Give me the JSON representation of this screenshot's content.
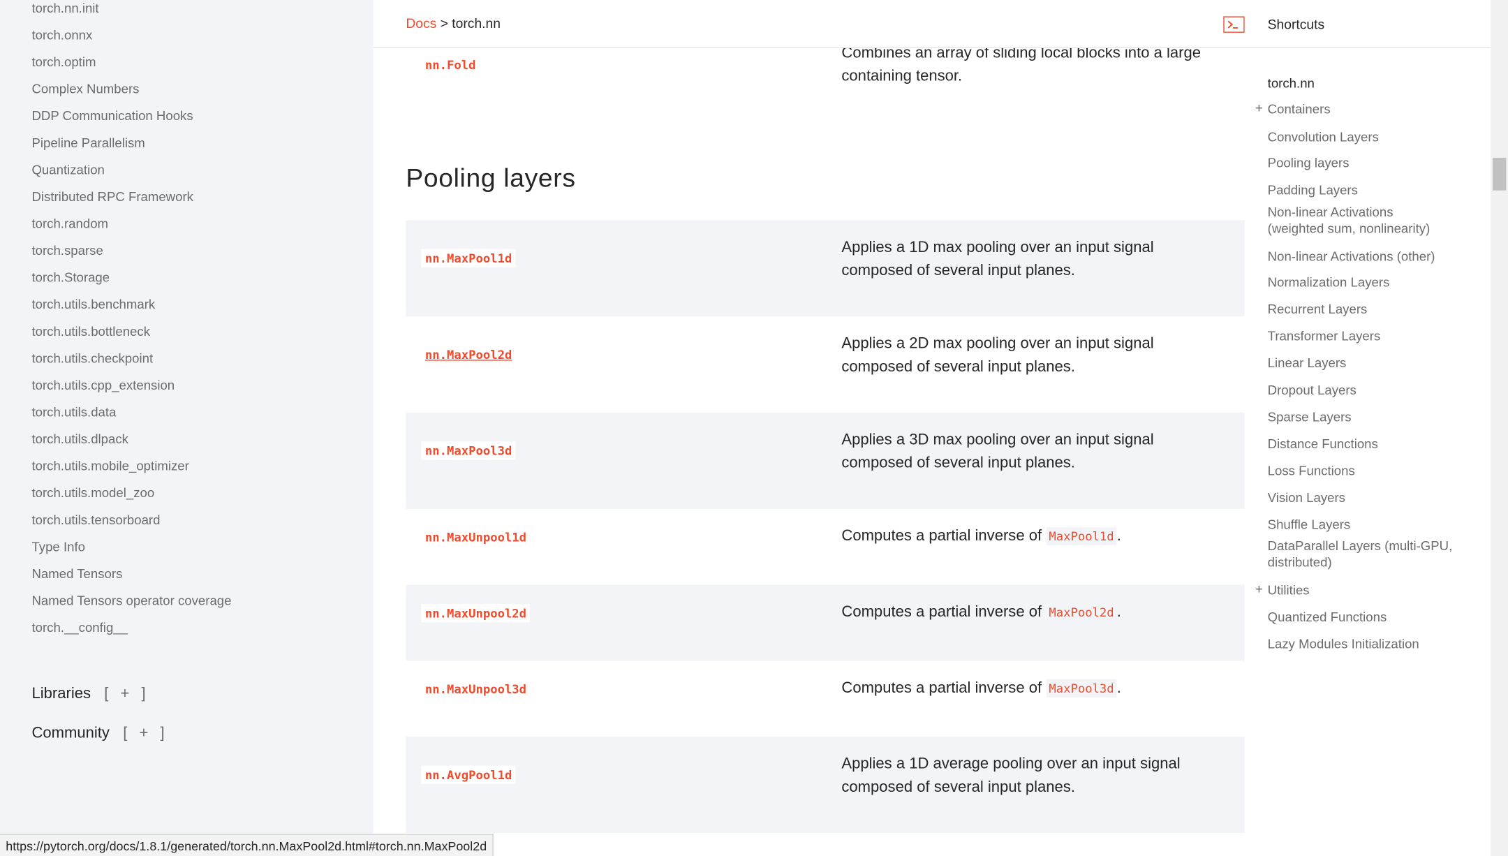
{
  "sidebar": {
    "items": [
      "torch.nn.init",
      "torch.onnx",
      "torch.optim",
      "Complex Numbers",
      "DDP Communication Hooks",
      "Pipeline Parallelism",
      "Quantization",
      "Distributed RPC Framework",
      "torch.random",
      "torch.sparse",
      "torch.Storage",
      "torch.utils.benchmark",
      "torch.utils.bottleneck",
      "torch.utils.checkpoint",
      "torch.utils.cpp_extension",
      "torch.utils.data",
      "torch.utils.dlpack",
      "torch.utils.mobile_optimizer",
      "torch.utils.model_zoo",
      "torch.utils.tensorboard",
      "Type Info",
      "Named Tensors",
      "Named Tensors operator coverage",
      "torch.__config__"
    ],
    "sections": [
      {
        "label": "Libraries",
        "expander": "[ + ]"
      },
      {
        "label": "Community",
        "expander": "[ + ]"
      }
    ]
  },
  "header": {
    "breadcrumb_link": "Docs",
    "breadcrumb_sep": ">",
    "breadcrumb_current": "torch.nn",
    "shortcuts_label": "Shortcuts"
  },
  "content": {
    "fold": {
      "code": "nn.Fold",
      "desc": "Combines an array of sliding local blocks into a large containing tensor."
    },
    "section_title": "Pooling layers",
    "rows": [
      {
        "code": "nn.MaxPool1d",
        "desc": "Applies a 1D max pooling over an input signal composed of several input planes."
      },
      {
        "code": "nn.MaxPool2d",
        "desc": "Applies a 2D max pooling over an input signal composed of several input planes."
      },
      {
        "code": "nn.MaxPool3d",
        "desc": "Applies a 3D max pooling over an input signal composed of several input planes."
      },
      {
        "code": "nn.MaxUnpool1d",
        "desc_prefix": "Computes a partial inverse of",
        "desc_code": "MaxPool1d",
        "desc_suffix": "."
      },
      {
        "code": "nn.MaxUnpool2d",
        "desc_prefix": "Computes a partial inverse of",
        "desc_code": "MaxPool2d",
        "desc_suffix": "."
      },
      {
        "code": "nn.MaxUnpool3d",
        "desc_prefix": "Computes a partial inverse of",
        "desc_code": "MaxPool3d",
        "desc_suffix": "."
      },
      {
        "code": "nn.AvgPool1d",
        "desc": "Applies a 1D average pooling over an input signal composed of several input planes."
      }
    ]
  },
  "right_nav": {
    "items": [
      {
        "label": "torch.nn"
      },
      {
        "label": "Containers",
        "expander": "+"
      },
      {
        "label": "Convolution Layers"
      },
      {
        "label": "Pooling layers"
      },
      {
        "label": "Padding Layers"
      },
      {
        "label": "Non-linear Activations (weighted sum, nonlinearity)"
      },
      {
        "label": "Non-linear Activations (other)"
      },
      {
        "label": "Normalization Layers"
      },
      {
        "label": "Recurrent Layers"
      },
      {
        "label": "Transformer Layers"
      },
      {
        "label": "Linear Layers"
      },
      {
        "label": "Dropout Layers"
      },
      {
        "label": "Sparse Layers"
      },
      {
        "label": "Distance Functions"
      },
      {
        "label": "Loss Functions"
      },
      {
        "label": "Vision Layers"
      },
      {
        "label": "Shuffle Layers"
      },
      {
        "label": "DataParallel Layers (multi-GPU, distributed)"
      },
      {
        "label": "Utilities",
        "expander": "+"
      },
      {
        "label": "Quantized Functions"
      },
      {
        "label": "Lazy Modules Initialization"
      }
    ]
  },
  "status_bar": {
    "url": "https://pytorch.org/docs/1.8.1/generated/torch.nn.MaxPool2d.html#torch.nn.MaxPool2d"
  },
  "colors": {
    "accent": "#ee4c2c",
    "sidebar_bg": "#f3f4f7",
    "text": "#262626",
    "muted": "#6c6c6d"
  },
  "icons": {
    "shortcuts": "terminal-prompt-icon",
    "expand": "plus-icon"
  }
}
